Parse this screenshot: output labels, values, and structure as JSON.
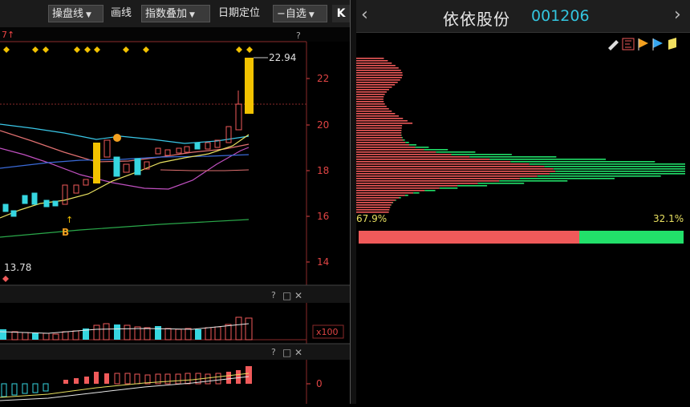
{
  "toolbar": {
    "draw_line_tool": "操盘线",
    "draw": "画线",
    "index_overlay": "指数叠加",
    "date_locate": "日期定位",
    "watchlist": "自选",
    "collapse": "K"
  },
  "kline": {
    "high_label": "22.94",
    "low_label": "13.78",
    "y_ticks": [
      "22",
      "20",
      "18",
      "16",
      "14"
    ],
    "b_marker": "B",
    "question_mark": "?"
  },
  "volume_panel": {
    "scale_label": "x100",
    "help": "?",
    "restore": "□",
    "close": "✕"
  },
  "macd_panel": {
    "zero_label": "0",
    "help": "?",
    "restore": "□",
    "close": "✕"
  },
  "stock": {
    "name": "依依股份",
    "code": "001206",
    "prev_arrow": "‹",
    "next_arrow": "›"
  },
  "chip_distribution": {
    "profit_ratio": "67.9%",
    "loss_ratio": "32.1%",
    "profit_fraction": 0.679,
    "profit_color": "#f05a5a",
    "loss_color": "#22e06a"
  },
  "icons": [
    "pen-icon",
    "chip-flag-red-icon",
    "chip-flag-orange-icon",
    "chip-flag-blue-icon",
    "chip-flag-yellow-icon"
  ]
}
